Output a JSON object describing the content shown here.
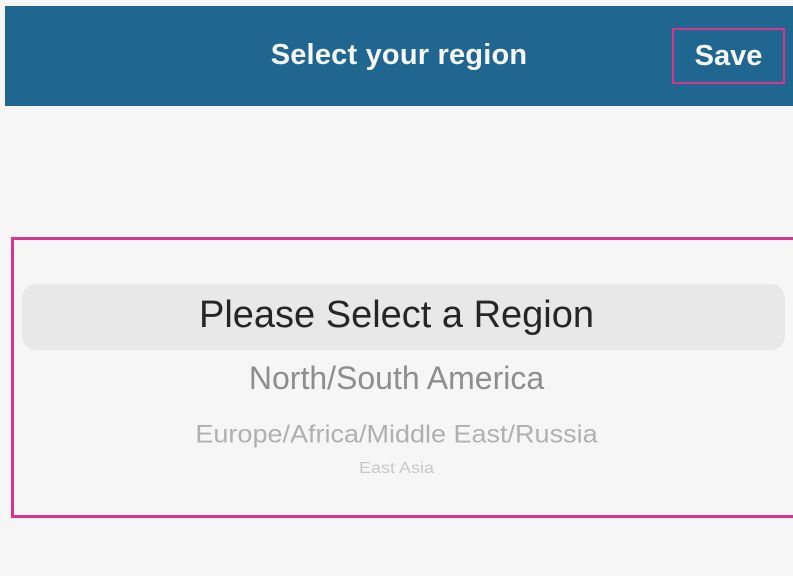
{
  "header": {
    "title": "Select your region",
    "save_label": "Save"
  },
  "picker": {
    "selected": "Please Select a Region",
    "options": [
      "North/South America",
      "Europe/Africa/Middle East/Russia",
      "East Asia"
    ]
  },
  "colors": {
    "header_background": "#1f6690",
    "highlight_border": "#d6378a",
    "page_background": "#f6f6f6",
    "selection_band": "#e8e8e8"
  }
}
